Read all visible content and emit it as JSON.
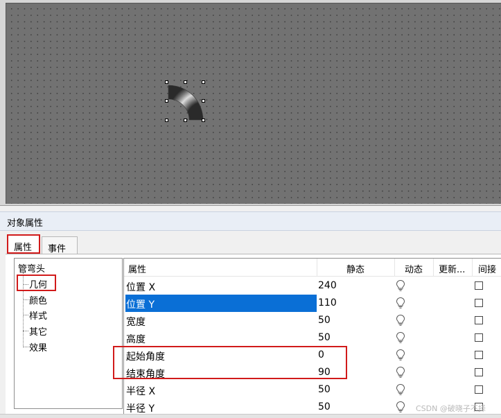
{
  "panel": {
    "title": "对象属性",
    "tabs": [
      "属性",
      "事件"
    ]
  },
  "tree": {
    "root": "管弯头",
    "items": [
      "几何",
      "颜色",
      "样式",
      "其它",
      "效果"
    ]
  },
  "grid": {
    "headers": [
      "属性",
      "静态",
      "动态",
      "更新...",
      "间接"
    ],
    "rows": [
      {
        "name": "位置 X",
        "value": "240",
        "selected": false
      },
      {
        "name": "位置 Y",
        "value": "110",
        "selected": true
      },
      {
        "name": "宽度",
        "value": "50",
        "selected": false
      },
      {
        "name": "高度",
        "value": "50",
        "selected": false
      },
      {
        "name": "起始角度",
        "value": "0",
        "selected": false
      },
      {
        "name": "结束角度",
        "value": "90",
        "selected": false
      },
      {
        "name": "半径 X",
        "value": "50",
        "selected": false
      },
      {
        "name": "半径 Y",
        "value": "50",
        "selected": false
      }
    ]
  },
  "icons": {
    "dynamic": "lightbulb-icon",
    "indirect": "checkbox"
  },
  "colors": {
    "selection": "#0a6fd6",
    "annotation": "#d11a1a",
    "canvas": "#727272"
  },
  "watermark": "CSDN @破晓子不择"
}
